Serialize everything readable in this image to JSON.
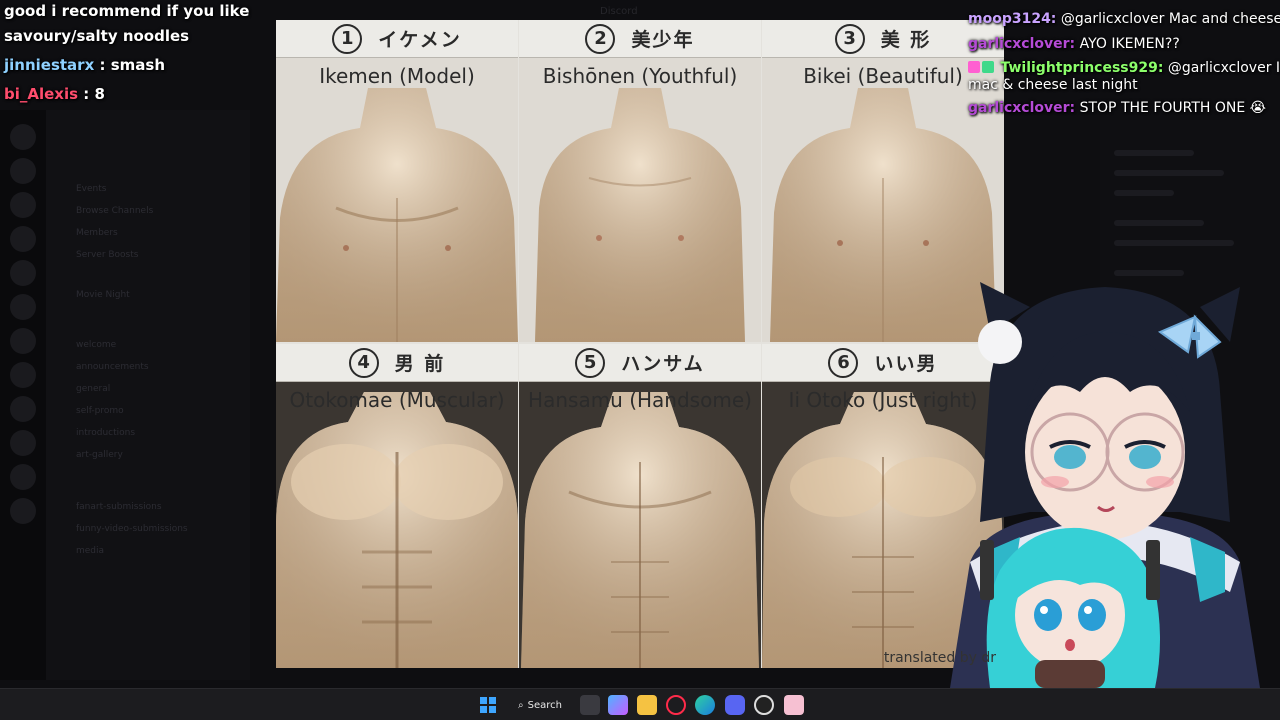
{
  "background_app": {
    "channels": [
      "Events",
      "Browse Channels",
      "Members",
      "Server Boosts",
      "Movie Night",
      "welcome",
      "announcements",
      "general",
      "self-promo",
      "introductions",
      "art-gallery",
      "fanart-submissions",
      "funny-video-submissions",
      "media"
    ],
    "window_title": "Discord"
  },
  "chart_image": {
    "panels": [
      {
        "num": "1",
        "jp": "イケメン",
        "en": "Ikemen (Model)"
      },
      {
        "num": "2",
        "jp": "美少年",
        "en": "Bishōnen (Youthful)"
      },
      {
        "num": "3",
        "jp": "美 形",
        "en": "Bikei (Beautiful)"
      },
      {
        "num": "4",
        "jp": "男 前",
        "en": "Otokomae (Muscular)"
      },
      {
        "num": "5",
        "jp": "ハンサム",
        "en": "Hansamu (Handsome)"
      },
      {
        "num": "6",
        "jp": "いい男",
        "en": "Ii Otoko (Just right)"
      }
    ],
    "credit": "translated by dr"
  },
  "overlay_chat_left": {
    "messages": [
      {
        "user": "",
        "text": "good i recommend if you like",
        "user_color": "#ffffff"
      },
      {
        "user": "",
        "text": "savoury/salty noodles",
        "user_color": "#ffffff"
      },
      {
        "user": "jinniestarx",
        "text": ": smash",
        "user_color": "#8fd1ff"
      },
      {
        "user": "bi_Alexis",
        "text": ": 8",
        "user_color": "#ff4d6d"
      }
    ]
  },
  "overlay_chat_right": {
    "messages": [
      {
        "user": "moop3124:",
        "text": "@garlicxclover Mac and cheese",
        "user_color": "#c9a3ff"
      },
      {
        "user": "garlicxclover:",
        "text": "AYO IKEMEN??",
        "user_color": "#b54bd6"
      },
      {
        "user": "Twilightprincess929:",
        "text": "@garlicxclover I a",
        "user_color": "#8cff6b"
      },
      {
        "user": "",
        "text": "mac & cheese last night",
        "user_color": "#ffffff"
      },
      {
        "user": "garlicxclover:",
        "text": "STOP THE FOURTH ONE 😭",
        "user_color": "#b54bd6"
      }
    ]
  },
  "taskbar": {
    "search_label": "Search",
    "icons": [
      "windows-start-icon",
      "task-view-icon",
      "copilot-icon",
      "file-explorer-icon",
      "opera-gx-icon",
      "edge-icon",
      "discord-icon",
      "obs-icon",
      "vtube-studio-icon"
    ]
  }
}
